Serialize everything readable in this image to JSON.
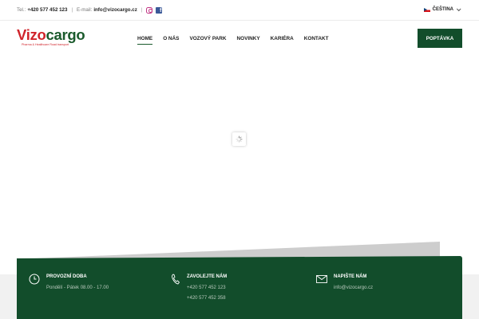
{
  "topbar": {
    "tel_label": "Tel.:",
    "tel_value": "+420 577 452 123",
    "separator": "|",
    "email_label": "E-mail:",
    "email_value": "info@vizocargo.cz",
    "social_icons": [
      "instagram-icon",
      "facebook-icon"
    ],
    "language": "ČEŠTINA"
  },
  "logo": {
    "part1": "Vizo",
    "part2": "cargo",
    "tagline": "Pharma & Healthcare Road transport"
  },
  "nav": {
    "items": [
      {
        "label": "HOME",
        "active": true
      },
      {
        "label": "O NÁS",
        "active": false
      },
      {
        "label": "VOZOVÝ PARK",
        "active": false
      },
      {
        "label": "NOVINKY",
        "active": false
      },
      {
        "label": "KARIÉRA",
        "active": false
      },
      {
        "label": "KONTAKT",
        "active": false
      }
    ],
    "cta_label": "POPTÁVKA"
  },
  "footer": {
    "hours": {
      "icon": "clock-icon",
      "title": "PROVOZNÍ DOBA",
      "lines": [
        "Pondělí - Pátek 08.00 - 17.00"
      ]
    },
    "call": {
      "icon": "phone-icon",
      "title": "ZAVOLEJTE NÁM",
      "lines": [
        "+420 577 452 123",
        "+420 577 452 358"
      ]
    },
    "write": {
      "icon": "envelope-icon",
      "title": "NAPIŠTE NÁM",
      "lines": [
        "info@vizocargo.cz"
      ]
    }
  },
  "colors": {
    "brand_green": "#124d2b",
    "brand_red": "#d0242b"
  }
}
